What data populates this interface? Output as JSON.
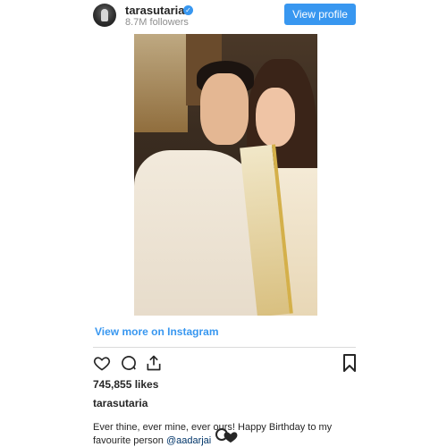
{
  "header": {
    "username": "tarasutaria",
    "verified_icon": "verified-badge-icon",
    "followers": "8.7M followers",
    "view_profile_label": "View profile"
  },
  "post": {
    "image_alt": "photo",
    "view_more_label": "View more on Instagram",
    "likes": "745,855 likes",
    "caption_user": "tarasutaria",
    "caption_text": "Ever thine, ever mine, ever ours! Happy Birthday to my favourite person ",
    "caption_mention": "@aadarjai"
  },
  "icons": {
    "like": "heart-icon",
    "comment": "comment-icon",
    "share": "share-icon",
    "save": "bookmark-icon",
    "emoji": "heart-emoji-icon"
  },
  "colors": {
    "accent": "#3897f0",
    "text": "#262626",
    "muted": "#8e8e8e",
    "divider": "#dbdbdb"
  }
}
